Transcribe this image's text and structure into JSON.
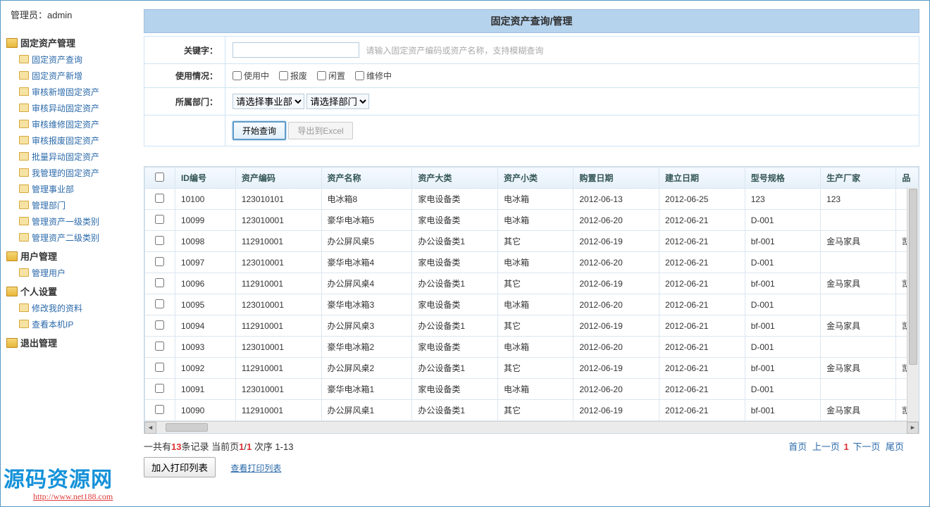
{
  "admin_label": "管理员：admin",
  "sidebar": [
    {
      "label": "固定资产管理",
      "open": true,
      "items": [
        "固定资产查询",
        "固定资产新增",
        "审核新增固定资产",
        "审核异动固定资产",
        "审核维修固定资产",
        "审核报废固定资产",
        "批量异动固定资产",
        "我管理的固定资产",
        "管理事业部",
        "管理部门",
        "管理资产一级类别",
        "管理资产二级类别"
      ]
    },
    {
      "label": "用户管理",
      "open": true,
      "items": [
        "管理用户"
      ]
    },
    {
      "label": "个人设置",
      "open": true,
      "items": [
        "修改我的资料",
        "查看本机IP"
      ]
    },
    {
      "label": "退出管理",
      "open": false,
      "items": []
    }
  ],
  "panel_title": "固定资产查询/管理",
  "form": {
    "keyword_label": "关键字：",
    "keyword_hint": "请输入固定资产编码或资产名称，支持模糊查询",
    "usage_label": "使用情况：",
    "usage_opts": [
      "使用中",
      "报废",
      "闲置",
      "维修中"
    ],
    "dept_label": "所属部门：",
    "dept_sel1": "请选择事业部",
    "dept_sel2": "请选择部门",
    "btn_search": "开始查询",
    "btn_export": "导出到Excel"
  },
  "grid": {
    "headers": [
      "ID编号",
      "资产编码",
      "资产名称",
      "资产大类",
      "资产小类",
      "购置日期",
      "建立日期",
      "型号规格",
      "生产厂家",
      "品"
    ],
    "rows": [
      [
        "10100",
        "123010101",
        "电冰箱8",
        "家电设备类",
        "电冰箱",
        "2012-06-13",
        "2012-06-25",
        "123",
        "123",
        ""
      ],
      [
        "10099",
        "123010001",
        "豪华电冰箱5",
        "家电设备类",
        "电冰箱",
        "2012-06-20",
        "2012-06-21",
        "D-001",
        "",
        ""
      ],
      [
        "10098",
        "112910001",
        "办公屏风桌5",
        "办公设备类1",
        "其它",
        "2012-06-19",
        "2012-06-21",
        "bf-001",
        "金马家具",
        "凯"
      ],
      [
        "10097",
        "123010001",
        "豪华电冰箱4",
        "家电设备类",
        "电冰箱",
        "2012-06-20",
        "2012-06-21",
        "D-001",
        "",
        ""
      ],
      [
        "10096",
        "112910001",
        "办公屏风桌4",
        "办公设备类1",
        "其它",
        "2012-06-19",
        "2012-06-21",
        "bf-001",
        "金马家具",
        "凯"
      ],
      [
        "10095",
        "123010001",
        "豪华电冰箱3",
        "家电设备类",
        "电冰箱",
        "2012-06-20",
        "2012-06-21",
        "D-001",
        "",
        ""
      ],
      [
        "10094",
        "112910001",
        "办公屏风桌3",
        "办公设备类1",
        "其它",
        "2012-06-19",
        "2012-06-21",
        "bf-001",
        "金马家具",
        "凯"
      ],
      [
        "10093",
        "123010001",
        "豪华电冰箱2",
        "家电设备类",
        "电冰箱",
        "2012-06-20",
        "2012-06-21",
        "D-001",
        "",
        ""
      ],
      [
        "10092",
        "112910001",
        "办公屏风桌2",
        "办公设备类1",
        "其它",
        "2012-06-19",
        "2012-06-21",
        "bf-001",
        "金马家具",
        "凯"
      ],
      [
        "10091",
        "123010001",
        "豪华电冰箱1",
        "家电设备类",
        "电冰箱",
        "2012-06-20",
        "2012-06-21",
        "D-001",
        "",
        ""
      ],
      [
        "10090",
        "112910001",
        "办公屏风桌1",
        "办公设备类1",
        "其它",
        "2012-06-19",
        "2012-06-21",
        "bf-001",
        "金马家具",
        "凯"
      ]
    ]
  },
  "footer": {
    "total_prefix": "一共有",
    "total_count": "13",
    "total_suffix": "条记录  当前页",
    "page_cur": "1",
    "page_sep": "/",
    "page_total": "1",
    "page_tail": " 次序  1-13",
    "pg_first": "首页",
    "pg_prev": "上一页",
    "pg_num": "1",
    "pg_next": "下一页",
    "pg_last": "尾页"
  },
  "print": {
    "add": "加入打印列表",
    "view": "查看打印列表"
  },
  "watermark": {
    "cn": "源码资源网",
    "url": "http://www.net188.com"
  }
}
